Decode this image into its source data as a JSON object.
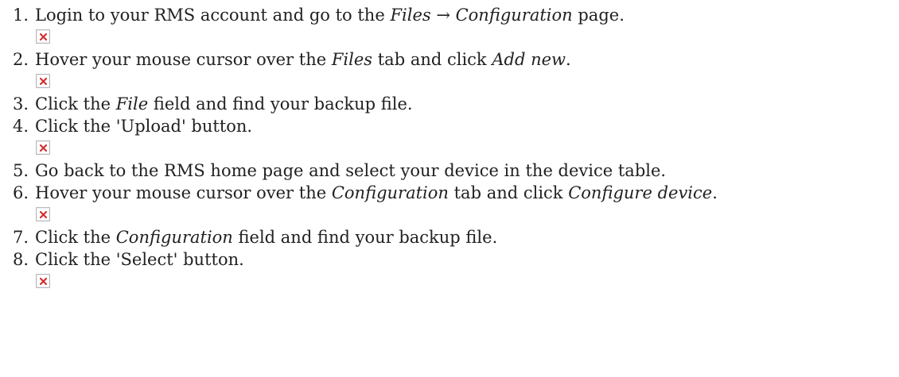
{
  "steps": [
    {
      "num": "1.",
      "parts": [
        {
          "t": "Login to your RMS account and go to the "
        },
        {
          "t": "Files → Configuration",
          "em": true
        },
        {
          "t": " page."
        }
      ],
      "image": true
    },
    {
      "num": "2.",
      "parts": [
        {
          "t": "Hover your mouse cursor over the "
        },
        {
          "t": "Files",
          "em": true
        },
        {
          "t": " tab and click "
        },
        {
          "t": "Add new",
          "em": true
        },
        {
          "t": "."
        }
      ],
      "image": true
    },
    {
      "num": "3.",
      "parts": [
        {
          "t": "Click the "
        },
        {
          "t": "File",
          "em": true
        },
        {
          "t": " field and find your backup file."
        }
      ],
      "image": false
    },
    {
      "num": "4.",
      "parts": [
        {
          "t": "Click the 'Upload' button."
        }
      ],
      "image": true
    },
    {
      "num": "5.",
      "parts": [
        {
          "t": "Go back to the RMS home page and select your device in the device table."
        }
      ],
      "image": false
    },
    {
      "num": "6.",
      "parts": [
        {
          "t": "Hover your mouse cursor over the "
        },
        {
          "t": "Configuration",
          "em": true
        },
        {
          "t": " tab and click "
        },
        {
          "t": "Configure device",
          "em": true
        },
        {
          "t": "."
        }
      ],
      "image": true
    },
    {
      "num": "7.",
      "parts": [
        {
          "t": "Click the "
        },
        {
          "t": "Configuration",
          "em": true
        },
        {
          "t": " field and find your backup file."
        }
      ],
      "image": false
    },
    {
      "num": "8.",
      "parts": [
        {
          "t": "Click the 'Select' button."
        }
      ],
      "image": true
    }
  ],
  "colors": {
    "text": "#202122",
    "broken_icon": "#d33131"
  },
  "icon": "broken-image-icon"
}
